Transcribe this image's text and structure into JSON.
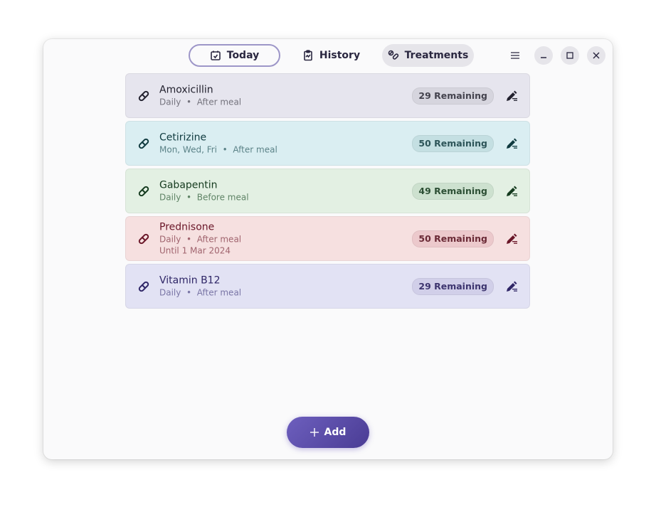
{
  "header": {
    "tabs": [
      {
        "label": "Today",
        "icon": "calendar-check-icon",
        "state": "outlined"
      },
      {
        "label": "History",
        "icon": "clipboard-icon",
        "state": "normal"
      },
      {
        "label": "Treatments",
        "icon": "pills-icon",
        "state": "selected"
      }
    ],
    "menu_icon": "hamburger-menu-icon",
    "window_controls": [
      "minimize-icon",
      "maximize-icon",
      "close-icon"
    ]
  },
  "treatments": [
    {
      "name": "Amoxicillin",
      "schedule": "Daily",
      "meal": "After meal",
      "extra": "",
      "remaining": "29 Remaining",
      "color": "#e6e5ee"
    },
    {
      "name": "Cetirizine",
      "schedule": "Mon, Wed, Fri",
      "meal": "After meal",
      "extra": "",
      "remaining": "50 Remaining",
      "color": "#daeef2"
    },
    {
      "name": "Gabapentin",
      "schedule": "Daily",
      "meal": "Before meal",
      "extra": "",
      "remaining": "49 Remaining",
      "color": "#e3f0e3"
    },
    {
      "name": "Prednisone",
      "schedule": "Daily",
      "meal": "After meal",
      "extra": "Until 1 Mar 2024",
      "remaining": "50 Remaining",
      "color": "#f6e0e0"
    },
    {
      "name": "Vitamin B12",
      "schedule": "Daily",
      "meal": "After meal",
      "extra": "",
      "remaining": "29 Remaining",
      "color": "#e2e2f4"
    }
  ],
  "separator": "•",
  "add_button": {
    "label": "Add",
    "icon": "plus-icon",
    "color": "#5a4ca8"
  }
}
